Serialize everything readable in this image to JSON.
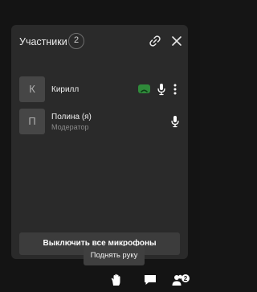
{
  "panel": {
    "title": "Участники",
    "count": "2",
    "mute_all_label": "Выключить все микрофоны"
  },
  "participants": [
    {
      "initial": "К",
      "name": "Кирилл",
      "role": "",
      "status_color": "#2f8a3a"
    },
    {
      "initial": "П",
      "name": "Полина (я)",
      "role": "Модератор"
    }
  ],
  "tooltip": {
    "text": "Поднять руку"
  },
  "toolbar": {
    "participants_count": "2"
  },
  "icons": {
    "header": [
      "link-icon",
      "close-icon"
    ],
    "row": [
      "video-status-icon",
      "microphone-icon",
      "more-vertical-icon"
    ],
    "toolbar": [
      "raise-hand-icon",
      "chat-icon",
      "participants-icon"
    ]
  }
}
